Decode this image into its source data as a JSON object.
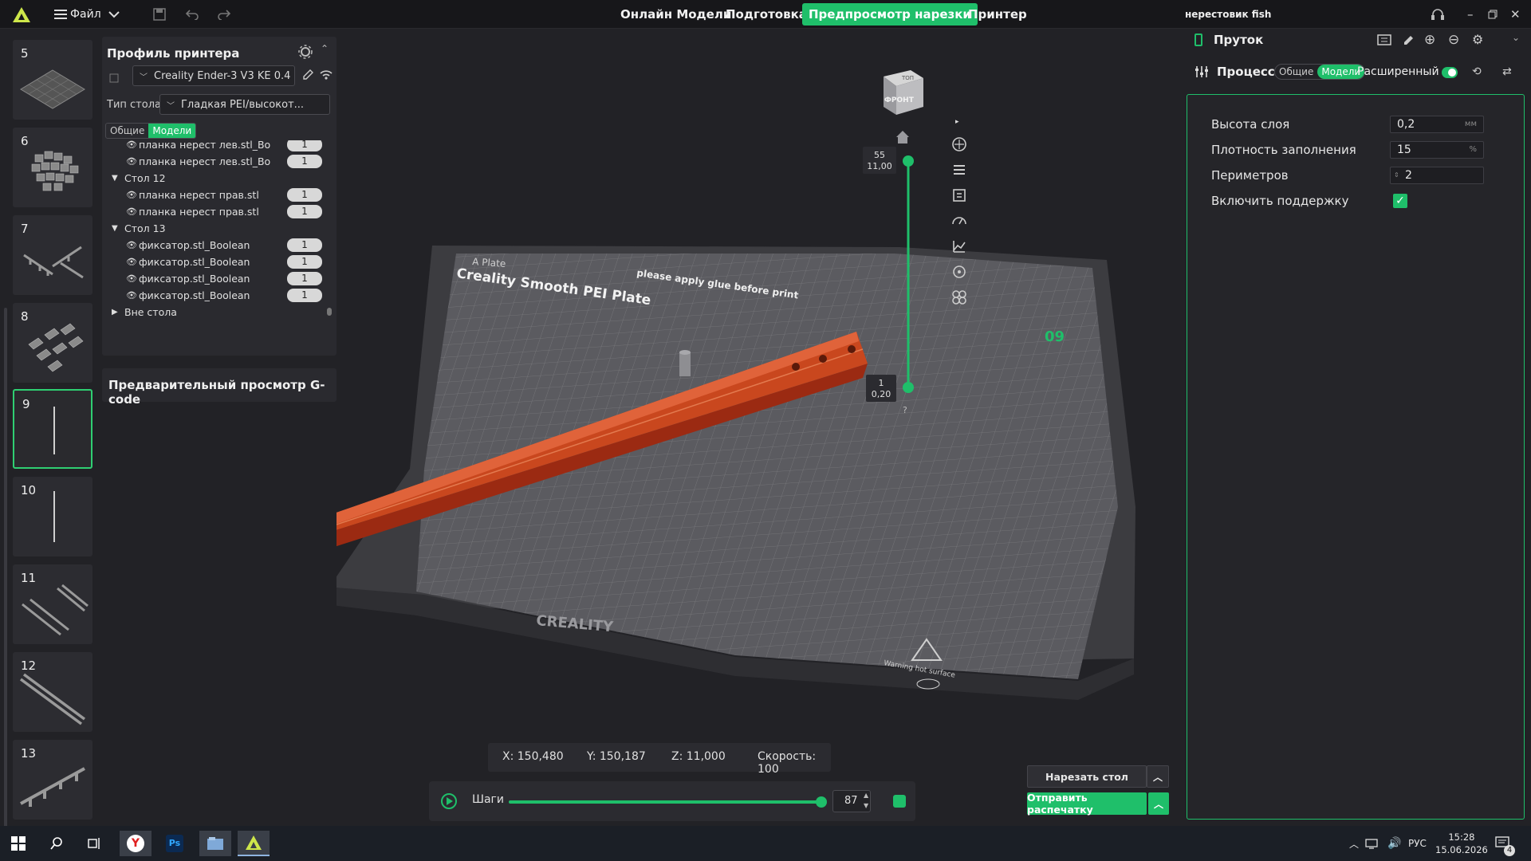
{
  "topbar": {
    "file_menu": "Файл",
    "tabs": [
      {
        "label": "Онлайн Модели",
        "active": false
      },
      {
        "label": "Подготовка",
        "active": false
      },
      {
        "label": "Предпросмотр нарезки",
        "active": true
      },
      {
        "label": "Принтер",
        "active": false
      }
    ],
    "project_name": "нерестовик fish"
  },
  "thumbnails": [
    {
      "num": "5",
      "active": false
    },
    {
      "num": "6",
      "active": false
    },
    {
      "num": "7",
      "active": false
    },
    {
      "num": "8",
      "active": false
    },
    {
      "num": "9",
      "active": true
    },
    {
      "num": "10",
      "active": false
    },
    {
      "num": "11",
      "active": false
    },
    {
      "num": "12",
      "active": false
    },
    {
      "num": "13",
      "active": false
    }
  ],
  "printer_profile": {
    "title": "Профиль принтера",
    "printer": "Creality Ender-3 V3 KE 0.4 ...",
    "bed_type_label": "Тип стола",
    "bed_type": "Гладкая PEI/высокот...",
    "segment": [
      "Общие",
      "Модели"
    ],
    "active_segment": "Модели"
  },
  "object_tree": [
    {
      "kind": "item",
      "name": "планка нерест  лев.stl_Bo",
      "count": "1"
    },
    {
      "kind": "item",
      "name": "планка нерест  лев.stl_Bo",
      "count": "1"
    },
    {
      "kind": "group",
      "name": "Стол 12",
      "expanded": true
    },
    {
      "kind": "item",
      "name": "планка нерест  прав.stl",
      "count": "1"
    },
    {
      "kind": "item",
      "name": "планка нерест  прав.stl",
      "count": "1"
    },
    {
      "kind": "group",
      "name": "Стол 13",
      "expanded": true
    },
    {
      "kind": "item",
      "name": "фиксатор.stl_Boolean",
      "count": "1"
    },
    {
      "kind": "item",
      "name": "фиксатор.stl_Boolean",
      "count": "1"
    },
    {
      "kind": "item",
      "name": "фиксатор.stl_Boolean",
      "count": "1"
    },
    {
      "kind": "item",
      "name": "фиксатор.stl_Boolean",
      "count": "1"
    },
    {
      "kind": "group",
      "name": "Вне стола",
      "expanded": false
    }
  ],
  "gcode_preview": "Предварительный просмотр G-code",
  "viewport": {
    "view_cube_top": "ТОП",
    "view_cube_front": "ФРОНТ",
    "plate_name": "Creality Smooth PEI Plate",
    "plate_tab": "A Plate",
    "plate_hint": "please apply glue before print",
    "brand": "CREALITY",
    "warning": "Warning hot surface",
    "plate_number": "09",
    "layer_top_num": "55",
    "layer_top_height": "11,00",
    "layer_bottom_num": "1",
    "layer_bottom_height": "0,20",
    "help": "?"
  },
  "coords": {
    "x": "X: 150,480",
    "y": "Y: 150,187",
    "z": "Z: 11,000",
    "speed": "Скорость: 100"
  },
  "steps": {
    "label": "Шаги",
    "value": "87",
    "progress": 1.0
  },
  "actions": {
    "slice": "Нарезать стол",
    "send": "Отправить распечатку"
  },
  "right_panel": {
    "filament_title": "Пруток",
    "process_title": "Процесс",
    "segment": [
      "Общие",
      "Модели"
    ],
    "active_segment": "Модели",
    "advanced_label": "Расширенный",
    "settings": [
      {
        "label": "Высота слоя",
        "value": "0,2",
        "unit": "мм"
      },
      {
        "label": "Плотность заполнения",
        "value": "15",
        "unit": "%"
      },
      {
        "label": "Периметров",
        "value": "2",
        "unit": ""
      }
    ],
    "support_label": "Включить поддержку",
    "support_enabled": true
  },
  "taskbar": {
    "lang": "РУС",
    "time": "15:28",
    "date": "15.06.2026",
    "notifications": "4"
  },
  "colors": {
    "accent": "#1fbf6a",
    "model": "#c9471e",
    "bg": "#222226"
  }
}
